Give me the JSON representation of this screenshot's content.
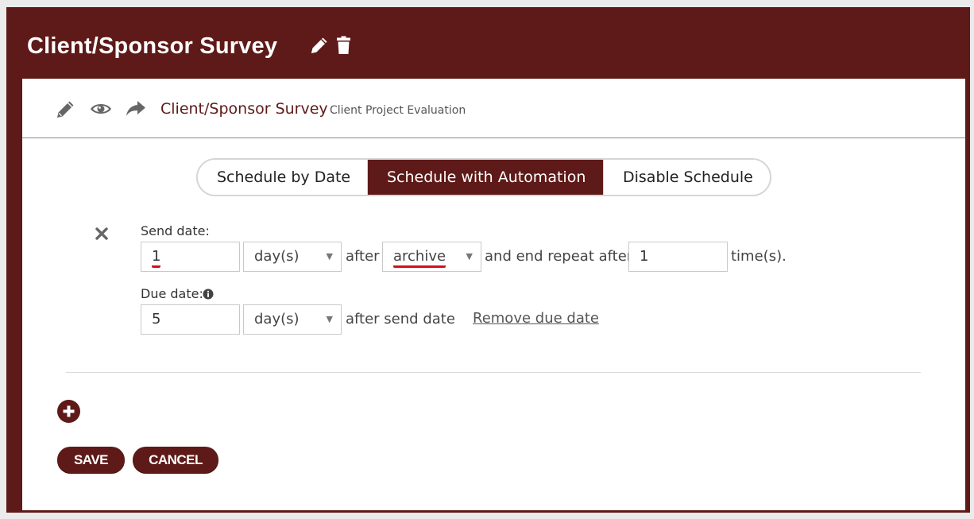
{
  "header": {
    "title": "Client/Sponsor Survey",
    "icons": [
      "pencil-icon",
      "trash-icon"
    ]
  },
  "subheader": {
    "icons": [
      "pencil-icon",
      "eye-icon",
      "share-arrow-icon"
    ],
    "survey_name": "Client/Sponsor Survey",
    "survey_subtitle": "Client Project Evaluation"
  },
  "schedule_tabs": [
    {
      "label": "Schedule by Date",
      "active": false
    },
    {
      "label": "Schedule with Automation",
      "active": true
    },
    {
      "label": "Disable Schedule",
      "active": false
    }
  ],
  "send_date": {
    "label": "Send date:",
    "amount": "1",
    "unit": "day(s)",
    "after_text": "after",
    "trigger": "archive",
    "repeat_text": "and end repeat after",
    "repeat_count": "1",
    "times_text": "time(s)."
  },
  "due_date": {
    "label": "Due date:",
    "amount": "5",
    "unit": "day(s)",
    "after_text": "after send date",
    "remove_link": "Remove due date"
  },
  "actions": {
    "save_label": "SAVE",
    "cancel_label": "CANCEL"
  },
  "colors": {
    "brand": "#5e1a18",
    "highlight_underline": "#d0121c"
  }
}
